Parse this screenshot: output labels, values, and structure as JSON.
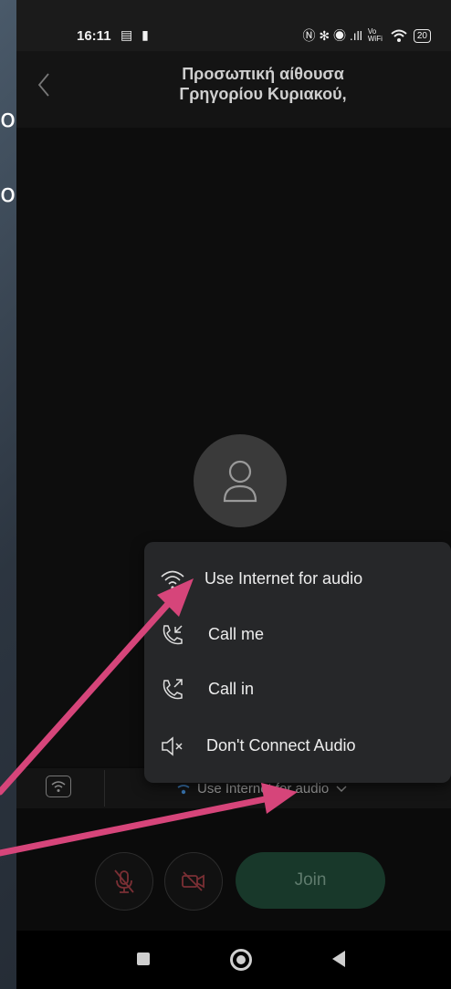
{
  "background_text": {
    "line1": "ουσας",
    "line2": "ο"
  },
  "status_bar": {
    "time": "16:11",
    "left_icons": "▤ ▮",
    "right_icons": "Ⓝ ✻ ◉ .ıll",
    "vowifi": "Vo WiFi",
    "battery": "20"
  },
  "header": {
    "back_icon": "chevron-left-icon",
    "title_line1": "Προσωπική αίθουσα",
    "title_line2": "Γρηγορίου Κυριακού,"
  },
  "audio_menu": {
    "items": [
      {
        "label": "Use Internet for audio",
        "icon": "wifi-icon"
      },
      {
        "label": "Call me",
        "icon": "phone-incoming-icon"
      },
      {
        "label": "Call in",
        "icon": "phone-outgoing-icon"
      },
      {
        "label": "Don't Connect Audio",
        "icon": "speaker-muted-icon"
      }
    ]
  },
  "audio_bar": {
    "selected": "Use Internet for audio"
  },
  "controls": {
    "join_label": "Join"
  },
  "colors": {
    "arrow": "#d6457a",
    "join_bg": "#18382a",
    "muted_red": "#7a2f34"
  }
}
